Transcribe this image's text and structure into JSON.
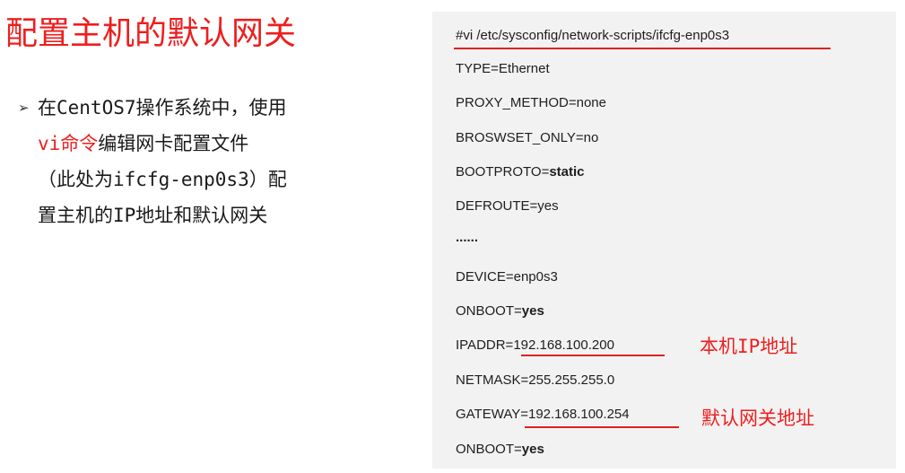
{
  "title": "配置主机的默认网关",
  "bullet": {
    "marker": "➢",
    "line1": "在CentOS7操作系统中，使用",
    "line2_red": "vi命令",
    "line2_rest": "编辑网卡配置文件",
    "line3": "（此处为ifcfg-enp0s3）配",
    "line4": "置主机的IP地址和默认网关"
  },
  "config": {
    "command": "#vi /etc/sysconfig/network-scripts/ifcfg-enp0s3",
    "type": "TYPE=Ethernet",
    "proxy_method": "PROXY_METHOD=none",
    "broswset_only": "BROSWSET_ONLY=no",
    "bootproto_key": "BOOTPROTO=",
    "bootproto_val": "static",
    "defroute": "DEFROUTE=yes",
    "ellipsis": "......",
    "device": "DEVICE=enp0s3",
    "onboot1_key": "ONBOOT=",
    "onboot1_val": "yes",
    "ipaddr_key": "IPADDR=",
    "ipaddr_val": "192.168.100.200",
    "netmask": "NETMASK=255.255.255.0",
    "gateway_key": "GATEWAY=",
    "gateway_val": "192.168.100.254",
    "onboot2_key": "ONBOOT=",
    "onboot2_val": "yes"
  },
  "annotations": {
    "ip": "本机IP地址",
    "gateway": "默认网关地址"
  },
  "colors": {
    "accent_red": "#ee1e1e",
    "panel_bg": "#f2f2f2"
  }
}
